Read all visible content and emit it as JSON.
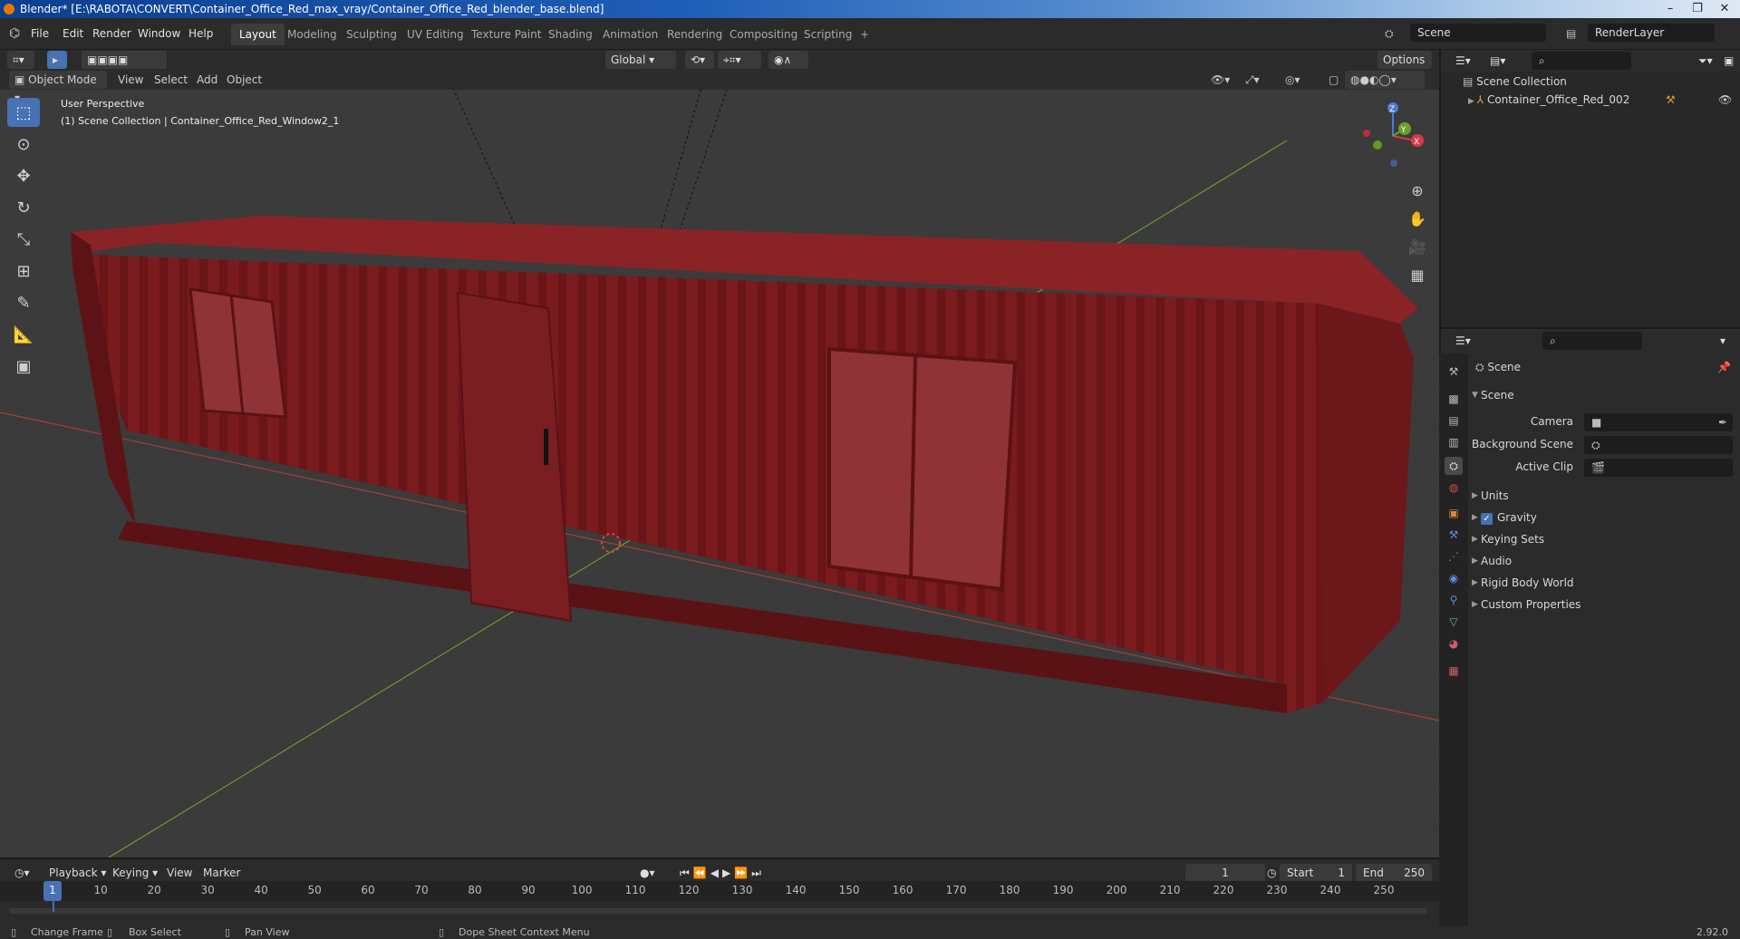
{
  "window": {
    "title": "Blender* [E:\\RABOTA\\CONVERT\\Container_Office_Red_max_vray/Container_Office_Red_blender_base.blend]"
  },
  "menubar": {
    "menus": [
      "File",
      "Edit",
      "Render",
      "Window",
      "Help"
    ],
    "workspaces": [
      "Layout",
      "Modeling",
      "Sculpting",
      "UV Editing",
      "Texture Paint",
      "Shading",
      "Animation",
      "Rendering",
      "Compositing",
      "Scripting"
    ],
    "active_workspace": "Layout",
    "add_tab": "+",
    "scene_name": "Scene",
    "view_layer": "RenderLayer"
  },
  "viewport_header": {
    "transform_orientation": "Global",
    "options_label": "Options",
    "mode": "Object Mode",
    "menus": [
      "View",
      "Select",
      "Add",
      "Object"
    ]
  },
  "viewport": {
    "perspective_label": "User Perspective",
    "collection_label": "(1) Scene Collection | Container_Office_Red_Window2_1",
    "gizmo_axes": {
      "x": "X",
      "y": "Y",
      "z": "Z"
    },
    "colors": {
      "container_red": "#7e1d20",
      "grid_bg": "#3b3b3b",
      "x_axis": "#b03a3a",
      "y_axis": "#6a9a28"
    }
  },
  "outliner": {
    "root": "Scene Collection",
    "items": [
      {
        "name": "Container_Office_Red_002"
      }
    ]
  },
  "properties": {
    "header": "Scene",
    "section": "Scene",
    "fields": [
      {
        "label": "Camera",
        "value": ""
      },
      {
        "label": "Background Scene",
        "value": ""
      },
      {
        "label": "Active Clip",
        "value": ""
      }
    ],
    "panels": [
      "Units",
      "Gravity",
      "Keying Sets",
      "Audio",
      "Rigid Body World",
      "Custom Properties"
    ],
    "gravity_checked": true
  },
  "timeline": {
    "menus": [
      "Playback",
      "Keying",
      "View",
      "Marker"
    ],
    "current_frame": "1",
    "start_label": "Start",
    "start": "1",
    "end_label": "End",
    "end": "250",
    "ticks": [
      "1",
      "10",
      "20",
      "30",
      "40",
      "50",
      "60",
      "70",
      "80",
      "90",
      "100",
      "110",
      "120",
      "130",
      "140",
      "150",
      "160",
      "170",
      "180",
      "190",
      "200",
      "210",
      "220",
      "230",
      "240",
      "250"
    ]
  },
  "statusbar": {
    "items": [
      "Change Frame",
      "Box Select",
      "Pan View",
      "Dope Sheet Context Menu"
    ],
    "version": "2.92.0"
  }
}
